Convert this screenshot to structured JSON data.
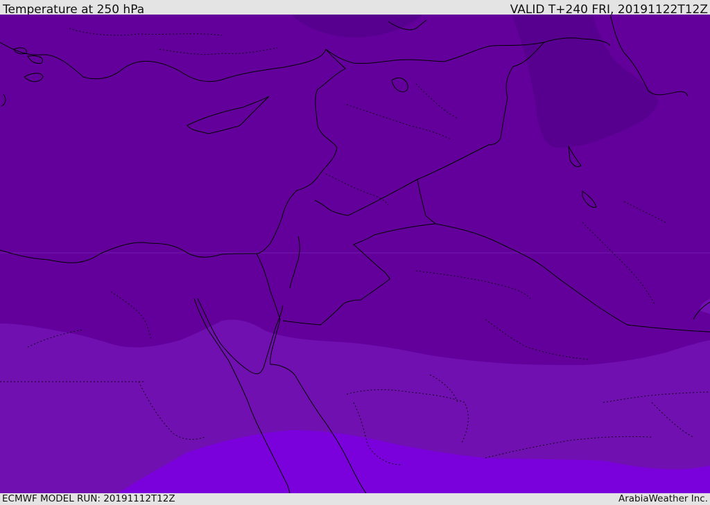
{
  "header": {
    "title": "Temperature at 250 hPa",
    "valid_time": "VALID T+240 FRI, 20191122T12Z"
  },
  "footer": {
    "model_run": "ECMWF MODEL RUN: 20191112T12Z",
    "credit": "ArabiaWeather Inc."
  },
  "colors": {
    "band_darkest": "#57008f",
    "band_dark": "#63009c",
    "band_mid": "#7110b0",
    "band_light": "#7a00dc",
    "borders": "#000000",
    "bar_background": "#e4e4e4"
  }
}
